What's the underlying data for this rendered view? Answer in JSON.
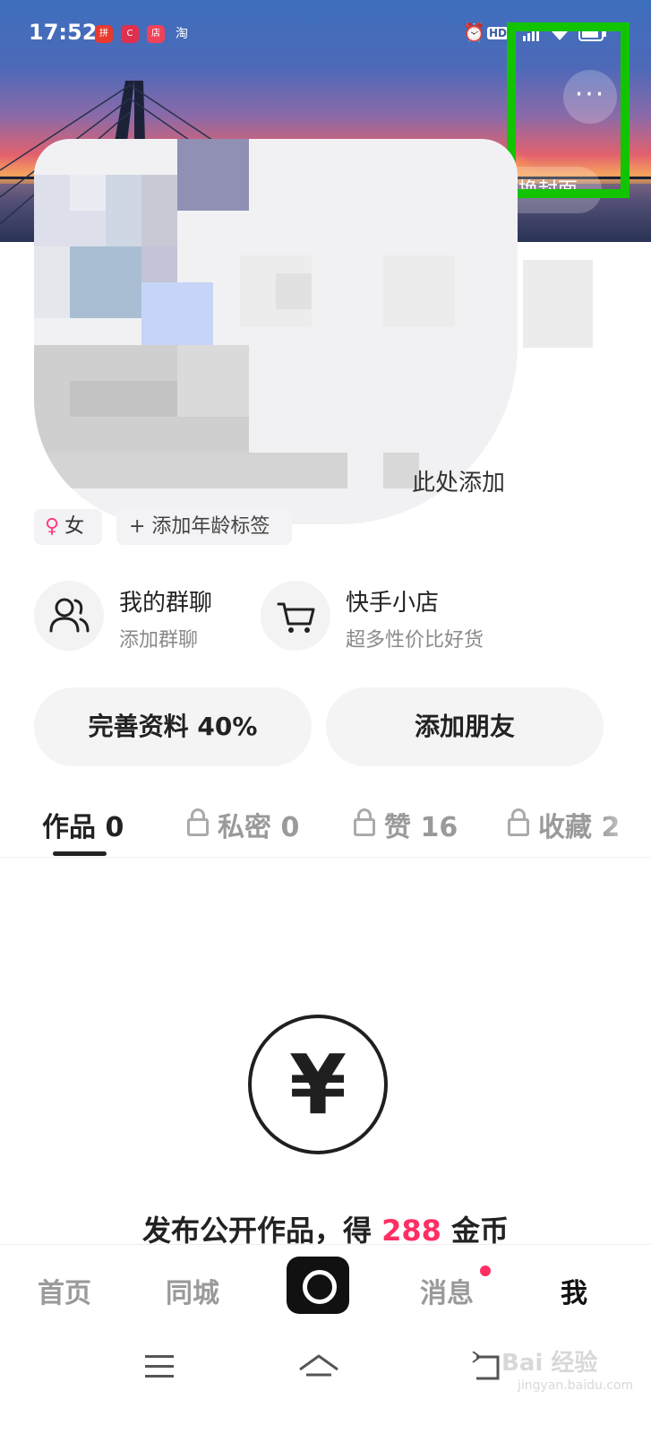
{
  "status_bar": {
    "time": "17:52",
    "apps": [
      "拼",
      "C",
      "店",
      "淘"
    ],
    "right_icons": [
      "alarm-icon",
      "hd-icon",
      "signal-icon",
      "wifi-icon",
      "battery-icon"
    ],
    "hd_label": "HD"
  },
  "header": {
    "more_label": "···",
    "cover_button_label": "更换封面"
  },
  "profile": {
    "bio_hint": "此处添加",
    "gender": "女",
    "gender_symbol": "♀",
    "age_tag": "+ 添加年龄标签"
  },
  "quick_entries": [
    {
      "title": "我的群聊",
      "subtitle": "添加群聊",
      "icon": "group-icon"
    },
    {
      "title": "快手小店",
      "subtitle": "超多性价比好货",
      "icon": "cart-icon"
    }
  ],
  "actions": {
    "complete_profile": "完善资料 40%",
    "add_friends": "添加朋友"
  },
  "tabs": [
    {
      "label": "作品 0",
      "locked": false,
      "active": true
    },
    {
      "label": "私密 0",
      "locked": true,
      "active": false
    },
    {
      "label": "赞 16",
      "locked": true,
      "active": false
    },
    {
      "label": "收藏 2",
      "locked": true,
      "active": false
    }
  ],
  "empty_state": {
    "icon_symbol": "¥",
    "promo_prefix": "发布公开作品，得 ",
    "promo_amount": "288",
    "promo_suffix": " 金币"
  },
  "bottom_nav": {
    "home": "首页",
    "local": "同城",
    "messages": "消息",
    "me": "我"
  },
  "colors": {
    "accent": "#ff2e63",
    "highlight_box": "#12c400"
  },
  "watermark": {
    "text": "Bai 经验",
    "sub": "jingyan.baidu.com"
  }
}
